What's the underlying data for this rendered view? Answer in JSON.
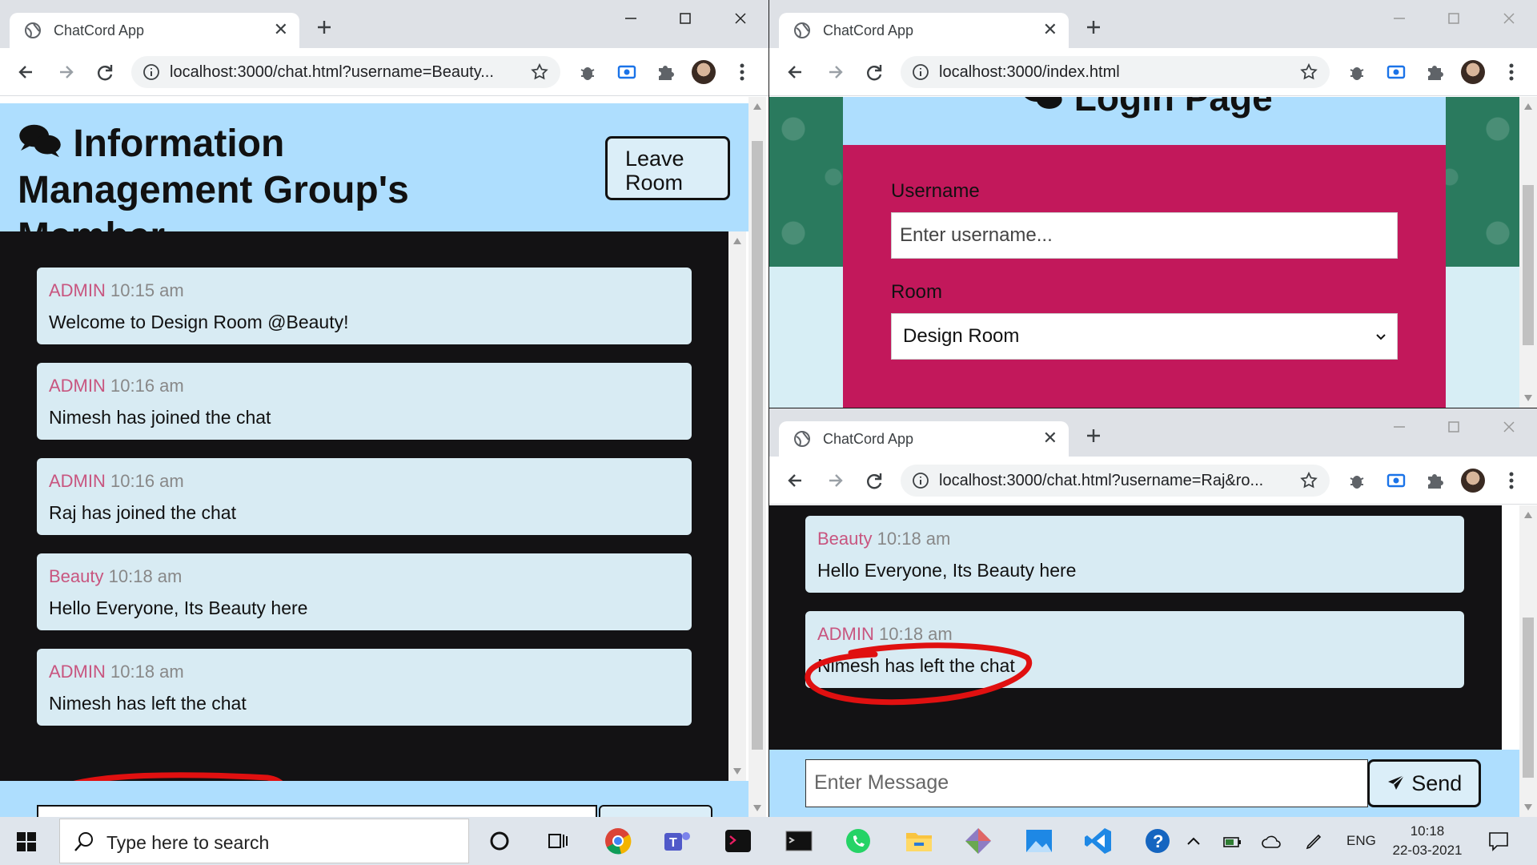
{
  "taskbar": {
    "search_placeholder": "Type here to search",
    "language": "ENG",
    "time": "10:18",
    "date": "22-03-2021"
  },
  "left_window": {
    "tab_title": "ChatCord App",
    "url": "localhost:3000/chat.html?username=Beauty...",
    "room_name": "Information Management Group's Member",
    "leave_label": "Leave Room",
    "messages": [
      {
        "user": "ADMIN",
        "time": "10:15 am",
        "text": "Welcome to Design Room @Beauty!"
      },
      {
        "user": "ADMIN",
        "time": "10:16 am",
        "text": "Nimesh has joined the chat"
      },
      {
        "user": "ADMIN",
        "time": "10:16 am",
        "text": "Raj has joined the chat"
      },
      {
        "user": "Beauty",
        "time": "10:18 am",
        "text": "Hello Everyone, Its Beauty here"
      },
      {
        "user": "ADMIN",
        "time": "10:18 am",
        "text": "Nimesh has left the chat"
      }
    ]
  },
  "top_right_window": {
    "tab_title": "ChatCord App",
    "url": "localhost:3000/index.html",
    "page_title": "Login Page",
    "username_label": "Username",
    "username_placeholder": "Enter username...",
    "room_label": "Room",
    "room_selected": "Design Room"
  },
  "bottom_right_window": {
    "tab_title": "ChatCord App",
    "url": "localhost:3000/chat.html?username=Raj&ro...",
    "messages": [
      {
        "user": "Beauty",
        "time": "10:18 am",
        "text": "Hello Everyone, Its Beauty here"
      },
      {
        "user": "ADMIN",
        "time": "10:18 am",
        "text": "Nimesh has left the chat"
      }
    ],
    "message_placeholder": "Enter Message",
    "send_label": "Send"
  },
  "colors": {
    "header_blue": "#aedefe",
    "message_bg": "#d8ebf3",
    "username_pink": "#c8557f",
    "login_magenta": "#c2185b",
    "annotation_red": "#e01010"
  }
}
